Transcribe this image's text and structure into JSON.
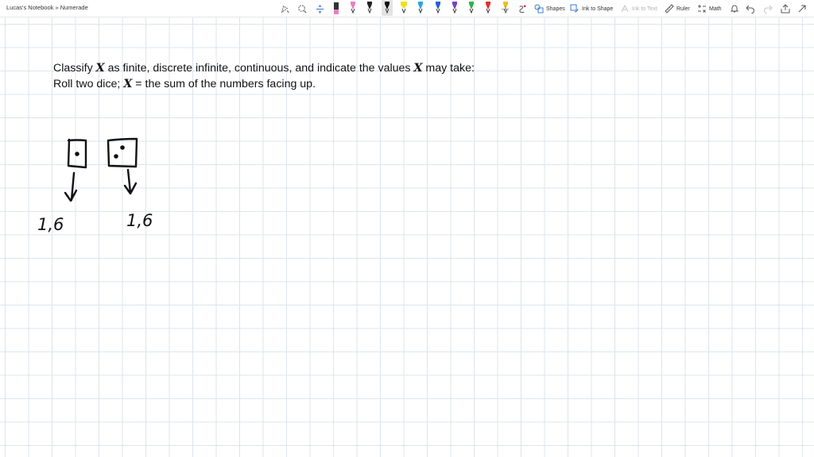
{
  "app": {
    "breadcrumb": "Lucas's Notebook » Numerade"
  },
  "toolbar": {
    "shapes_label": "Shapes",
    "ink_to_shape_label": "Ink to Shape",
    "ink_to_text_label": "Ink to Text",
    "ruler_label": "Ruler",
    "math_label": "Math",
    "icons": [
      "lasso-icon",
      "add-space-icon",
      "eraser-icon",
      "pen-icon",
      "highlighter-icon",
      "add-pen-icon",
      "ink-replay-icon",
      "bell-icon",
      "undo-icon",
      "redo-icon",
      "share-icon",
      "expand-icon"
    ],
    "pens": [
      {
        "color": "#e87fc4",
        "kind": "pen"
      },
      {
        "color": "#222222",
        "kind": "pen"
      },
      {
        "color": "#111111",
        "kind": "pen",
        "selected": true
      },
      {
        "color": "#f2e11b",
        "kind": "highlighter"
      },
      {
        "color": "#2aa6e0",
        "kind": "pen"
      },
      {
        "color": "#1f5fd6",
        "kind": "pen"
      },
      {
        "color": "#7a3fc8",
        "kind": "pen"
      },
      {
        "color": "#2bb54a",
        "kind": "pen"
      },
      {
        "color": "#e03030",
        "kind": "pen"
      },
      {
        "color": "#f0c020",
        "kind": "pen"
      }
    ]
  },
  "problem": {
    "line1_pre": "Classify ",
    "var": "X",
    "line1_mid": " as finite, discrete infinite, continuous, and indicate the values ",
    "line1_post": " may take:",
    "line2_pre": "Roll two dice; ",
    "line2_eq": " = ",
    "line2_post": "the sum of the numbers facing up."
  },
  "handwriting": {
    "die1_range": "1,6",
    "die2_range": "1,6"
  }
}
